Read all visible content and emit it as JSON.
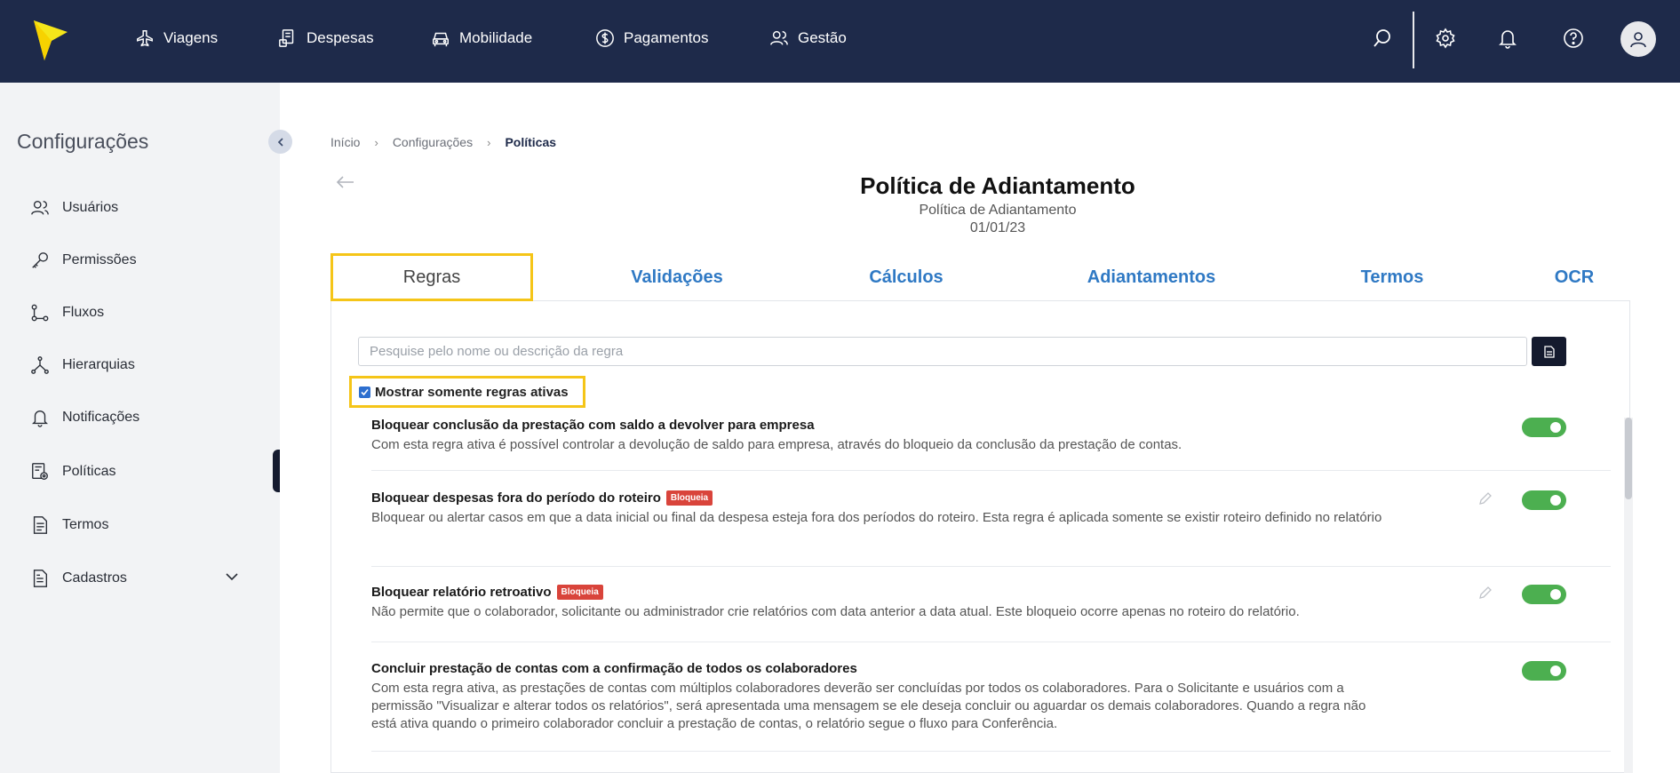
{
  "nav": {
    "items": [
      {
        "label": "Viagens",
        "icon": "plane-icon"
      },
      {
        "label": "Despesas",
        "icon": "receipt-icon"
      },
      {
        "label": "Mobilidade",
        "icon": "car-icon"
      },
      {
        "label": "Pagamentos",
        "icon": "dollar-icon"
      },
      {
        "label": "Gestão",
        "icon": "users-icon"
      }
    ],
    "actions": [
      "search-icon",
      "gear-icon",
      "bell-icon",
      "help-icon",
      "avatar-icon"
    ]
  },
  "sidebar": {
    "title": "Configurações",
    "items": [
      {
        "label": "Usuários",
        "icon": "users-icon"
      },
      {
        "label": "Permissões",
        "icon": "key-icon"
      },
      {
        "label": "Fluxos",
        "icon": "flow-icon"
      },
      {
        "label": "Hierarquias",
        "icon": "hierarchy-icon"
      },
      {
        "label": "Notificações",
        "icon": "bell-icon"
      },
      {
        "label": "Políticas",
        "icon": "policy-icon"
      },
      {
        "label": "Termos",
        "icon": "document-icon"
      },
      {
        "label": "Cadastros",
        "icon": "register-icon"
      }
    ],
    "active": "Políticas"
  },
  "breadcrumb": {
    "items": [
      "Início",
      "Configurações",
      "Políticas"
    ]
  },
  "page": {
    "title": "Política de Adiantamento",
    "subtitle": "Política de Adiantamento",
    "date": "01/01/23"
  },
  "tabs": [
    {
      "label": "Regras",
      "active": true
    },
    {
      "label": "Validações",
      "active": false
    },
    {
      "label": "Cálculos",
      "active": false
    },
    {
      "label": "Adiantamentos",
      "active": false
    },
    {
      "label": "Termos",
      "active": false
    },
    {
      "label": "OCR",
      "active": false
    }
  ],
  "search": {
    "placeholder": "Pesquise pelo nome ou descrição da regra"
  },
  "filter": {
    "label": "Mostrar somente regras ativas",
    "checked": true
  },
  "rules": [
    {
      "title": "Bloquear conclusão da prestação com saldo a devolver para empresa",
      "badge": "",
      "description": "Com esta regra ativa é possível controlar a devolução de saldo para empresa, através do bloqueio da conclusão da prestação de contas.",
      "enabled": true,
      "editable": false
    },
    {
      "title": "Bloquear despesas fora do período do roteiro",
      "badge": "Bloqueia",
      "description": "Bloquear ou alertar casos em que a data inicial ou final da despesa esteja fora dos períodos do roteiro. Esta regra é aplicada somente se existir roteiro definido no relatório",
      "enabled": true,
      "editable": true
    },
    {
      "title": "Bloquear relatório retroativo",
      "badge": "Bloqueia",
      "description": "Não permite que o colaborador, solicitante ou administrador crie relatórios com data anterior a data atual. Este bloqueio ocorre apenas no roteiro do relatório.",
      "enabled": true,
      "editable": true
    },
    {
      "title": "Concluir prestação de contas com a confirmação de todos os colaboradores",
      "badge": "",
      "description": "Com esta regra ativa, as prestações de contas com múltiplos colaboradores deverão ser concluídas por todos os colaboradores. Para o Solicitante e usuários com a permissão \"Visualizar e alterar todos os relatórios\", será apresentada uma mensagem se ele deseja concluir ou aguardar os demais colaboradores. Quando a regra não está ativa quando o primeiro colaborador concluir a prestação de contas, o relatório segue o fluxo para Conferência.",
      "enabled": true,
      "editable": false
    }
  ],
  "colors": {
    "topbar": "#1e2a4a",
    "accent_tab": "#2f79c4",
    "highlight": "#f5c518",
    "toggle_on": "#4caf50",
    "badge": "#d9443b"
  }
}
